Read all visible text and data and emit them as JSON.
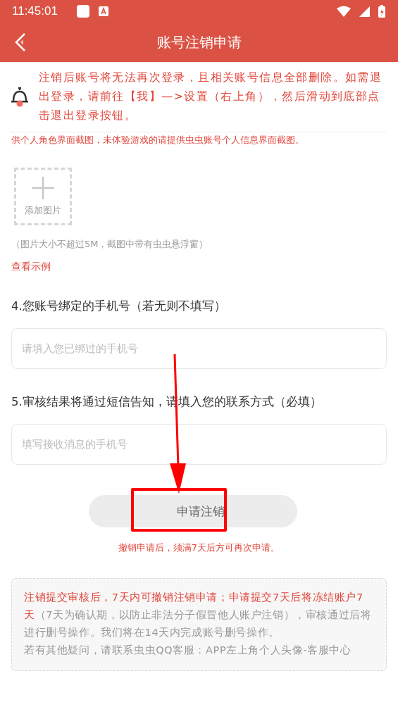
{
  "status_bar": {
    "time": "11:45:01"
  },
  "header": {
    "title": "账号注销申请"
  },
  "notice": {
    "text": "注销后账号将无法再次登录，且相关账号信息全部删除。如需退出登录，请前往【我】—>设置（右上角），然后滑动到底部点击退出登录按钮。"
  },
  "screenshot_hint": "供个人角色界面截图，未体验游戏的请提供虫虫账号个人信息界面截图。",
  "upload": {
    "label": "添加图片",
    "size_note": "（图片大小不超过5M，截图中带有虫虫悬浮窗）",
    "example_link": "查看示例"
  },
  "questions": [
    {
      "label": "4.您账号绑定的手机号（若无则不填写）",
      "placeholder": "请填入您已绑过的手机号"
    },
    {
      "label": "5.审核结果将通过短信告知，请填入您的联系方式（必填）",
      "placeholder": "填写接收消息的手机号"
    }
  ],
  "submit_button": {
    "label": "申请注销",
    "highlighted": true
  },
  "submit_note": "撤销申请后，须满7天后方可再次申请。",
  "annotation": {
    "arrow": true
  },
  "info": {
    "segments": [
      {
        "text": "注销提交审核后，7天内可撤销注销申请；申请提交7天后将冻结账户7天",
        "emphasis": true
      },
      {
        "text": "（7天为确认期，以防止非法分子假冒他人账户注销），审核通过后将进行删号操作。我们将在14天内完成账号删号操作。",
        "emphasis": false
      }
    ],
    "contact": "若有其他疑问，请联系虫虫QQ客服：APP左上角个人头像-客服中心"
  }
}
